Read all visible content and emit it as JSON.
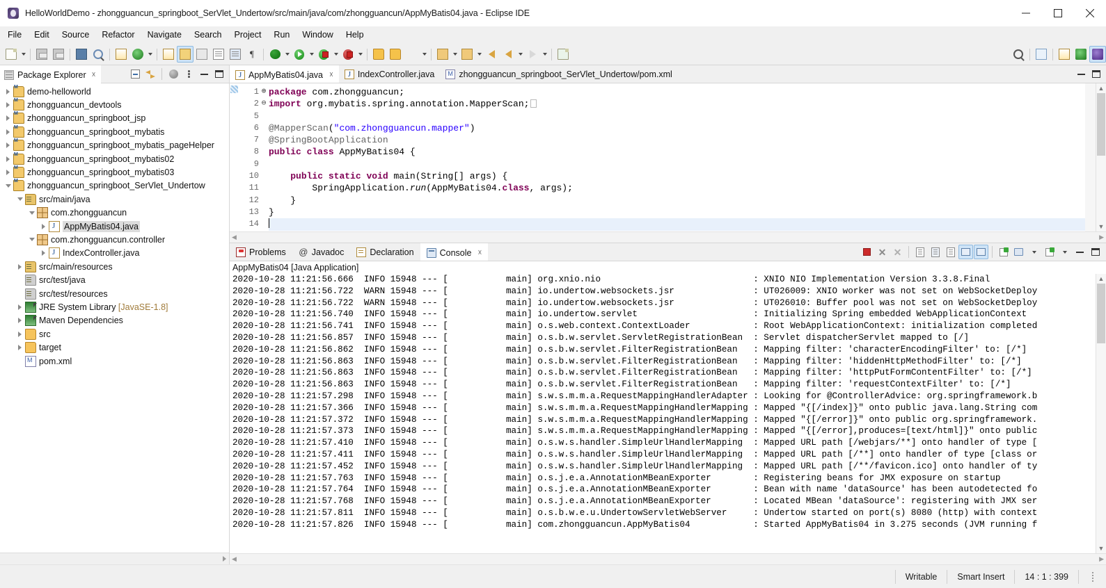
{
  "window": {
    "title": "HelloWorldDemo - zhongguancun_springboot_SerVlet_Undertow/src/main/java/com/zhongguancun/AppMyBatis04.java - Eclipse IDE",
    "app_icon": "eclipse-icon",
    "minimize": "—",
    "maximize": "□",
    "close": "✕"
  },
  "menubar": {
    "items": [
      {
        "label": "File"
      },
      {
        "label": "Edit"
      },
      {
        "label": "Source"
      },
      {
        "label": "Refactor"
      },
      {
        "label": "Navigate"
      },
      {
        "label": "Search"
      },
      {
        "label": "Project"
      },
      {
        "label": "Run"
      },
      {
        "label": "Window"
      },
      {
        "label": "Help"
      }
    ]
  },
  "toolbar": {
    "icons": [
      "new-wizard-icon",
      "save-icon",
      "save-all-icon",
      "print-icon",
      "search-icon",
      "open-task-icon",
      "refresh-icon",
      "annotate-icon",
      "edit-highlight-icon",
      "link-icon",
      "new-java-project-icon",
      "new-class-icon",
      "paragraph-icon",
      "debug-icon",
      "run-icon",
      "run-last-icon",
      "coverage-icon",
      "open-type-icon",
      "open-folder-icon",
      "pen-icon",
      "next-annotation-icon",
      "prev-annotation-icon",
      "back-icon",
      "forward-icon",
      "goto-icon",
      "new-file-icon"
    ],
    "right_icons": [
      "search-icon",
      "open-perspective-icon",
      "java-perspective-icon",
      "debug-perspective-icon",
      "java-ee-perspective-icon"
    ]
  },
  "package_explorer": {
    "tab_label": "Package Explorer",
    "tab_icon": "package-explorer-icon",
    "tools": [
      "collapse-all-icon",
      "link-with-editor-icon",
      "view-menu-globe-icon",
      "view-menu-icon",
      "minimize-icon",
      "maximize-icon"
    ],
    "tree": [
      {
        "label": "demo-helloworld",
        "indent": 0,
        "twist": "right",
        "icon": "maven-project-icon"
      },
      {
        "label": "zhongguancun_devtools",
        "indent": 0,
        "twist": "right",
        "icon": "maven-project-icon"
      },
      {
        "label": "zhongguancun_springboot_jsp",
        "indent": 0,
        "twist": "right",
        "icon": "maven-project-icon"
      },
      {
        "label": "zhongguancun_springboot_mybatis",
        "indent": 0,
        "twist": "right",
        "icon": "maven-project-icon"
      },
      {
        "label": "zhongguancun_springboot_mybatis_pageHelper",
        "indent": 0,
        "twist": "right",
        "icon": "maven-project-icon"
      },
      {
        "label": "zhongguancun_springboot_mybatis02",
        "indent": 0,
        "twist": "right",
        "icon": "maven-project-icon"
      },
      {
        "label": "zhongguancun_springboot_mybatis03",
        "indent": 0,
        "twist": "right",
        "icon": "maven-project-icon"
      },
      {
        "label": "zhongguancun_springboot_SerVlet_Undertow",
        "indent": 0,
        "twist": "down",
        "icon": "maven-project-icon"
      },
      {
        "label": "src/main/java",
        "indent": 1,
        "twist": "down",
        "icon": "source-folder-icon"
      },
      {
        "label": "com.zhongguancun",
        "indent": 2,
        "twist": "down",
        "icon": "package-icon"
      },
      {
        "label": "AppMyBatis04.java",
        "indent": 3,
        "twist": "right",
        "icon": "java-file-icon",
        "selected": true
      },
      {
        "label": "com.zhongguancun.controller",
        "indent": 2,
        "twist": "down",
        "icon": "package-icon"
      },
      {
        "label": "IndexController.java",
        "indent": 3,
        "twist": "right",
        "icon": "java-file-icon"
      },
      {
        "label": "src/main/resources",
        "indent": 1,
        "twist": "right",
        "icon": "source-folder-icon"
      },
      {
        "label": "src/test/java",
        "indent": 1,
        "twist": "none",
        "icon": "source-folder-gray-icon"
      },
      {
        "label": "src/test/resources",
        "indent": 1,
        "twist": "none",
        "icon": "source-folder-gray-icon"
      },
      {
        "label": "JRE System Library",
        "suffix": " [JavaSE-1.8]",
        "indent": 1,
        "twist": "right",
        "icon": "library-icon"
      },
      {
        "label": "Maven Dependencies",
        "indent": 1,
        "twist": "right",
        "icon": "library-icon"
      },
      {
        "label": "src",
        "indent": 1,
        "twist": "right",
        "icon": "folder-icon"
      },
      {
        "label": "target",
        "indent": 1,
        "twist": "right",
        "icon": "folder-icon"
      },
      {
        "label": "pom.xml",
        "indent": 1,
        "twist": "none",
        "icon": "xml-file-icon"
      }
    ]
  },
  "editor": {
    "tabs": [
      {
        "label": "AppMyBatis04.java",
        "icon": "java-file-icon",
        "active": true,
        "closable": true
      },
      {
        "label": "IndexController.java",
        "icon": "java-file-icon",
        "active": false,
        "closable": false
      },
      {
        "label": "zhongguancun_springboot_SerVlet_Undertow/pom.xml",
        "icon": "xml-file-icon",
        "active": false,
        "closable": false
      }
    ],
    "tools": [
      "minimize-icon",
      "maximize-icon"
    ],
    "line_numbers": [
      "1",
      "2",
      "5",
      "6",
      "7",
      "8",
      "9",
      "10",
      "11",
      "12",
      "13",
      "14"
    ],
    "fold_markers": [
      "",
      "⊕",
      "",
      "",
      "",
      "",
      "",
      "⊖",
      "",
      "",
      "",
      ""
    ],
    "code_lines": [
      "package com.zhongguancun;",
      "import org.mybatis.spring.annotation.MapperScan;",
      "",
      "@MapperScan(\"com.zhongguancun.mapper\")",
      "@SpringBootApplication",
      "public class AppMyBatis04 {",
      "",
      "    public static void main(String[] args) {",
      "        SpringApplication.run(AppMyBatis04.class, args);",
      "    }",
      "}",
      ""
    ],
    "current_line_index": 11
  },
  "console_view": {
    "tabs": [
      {
        "label": "Problems",
        "icon": "problems-icon",
        "active": false
      },
      {
        "label": "Javadoc",
        "icon": "javadoc-at-icon",
        "active": false
      },
      {
        "label": "Declaration",
        "icon": "declaration-icon",
        "active": false
      },
      {
        "label": "Console",
        "icon": "console-icon",
        "active": true,
        "closable": true
      }
    ],
    "tools": [
      "terminate-icon",
      "remove-launch-icon",
      "remove-all-terminated-icon",
      "clear-console-icon",
      "lock-scroll-icon",
      "word-wrap-icon",
      "scroll-lock-icon",
      "show-console-on-output-icon",
      "pin-console-icon",
      "display-selected-console-icon",
      "open-console-icon",
      "minimize-icon",
      "maximize-icon"
    ],
    "title": "AppMyBatis04 [Java Application]",
    "log_lines": [
      "2020-10-28 11:21:56.666  INFO 15948 --- [           main] org.xnio.nio                             : XNIO NIO Implementation Version 3.3.8.Final",
      "2020-10-28 11:21:56.722  WARN 15948 --- [           main] io.undertow.websockets.jsr               : UT026009: XNIO worker was not set on WebSocketDeploy",
      "2020-10-28 11:21:56.722  WARN 15948 --- [           main] io.undertow.websockets.jsr               : UT026010: Buffer pool was not set on WebSocketDeploy",
      "2020-10-28 11:21:56.740  INFO 15948 --- [           main] io.undertow.servlet                      : Initializing Spring embedded WebApplicationContext",
      "2020-10-28 11:21:56.741  INFO 15948 --- [           main] o.s.web.context.ContextLoader            : Root WebApplicationContext: initialization completed",
      "2020-10-28 11:21:56.857  INFO 15948 --- [           main] o.s.b.w.servlet.ServletRegistrationBean  : Servlet dispatcherServlet mapped to [/]",
      "2020-10-28 11:21:56.862  INFO 15948 --- [           main] o.s.b.w.servlet.FilterRegistrationBean   : Mapping filter: 'characterEncodingFilter' to: [/*]",
      "2020-10-28 11:21:56.863  INFO 15948 --- [           main] o.s.b.w.servlet.FilterRegistrationBean   : Mapping filter: 'hiddenHttpMethodFilter' to: [/*]",
      "2020-10-28 11:21:56.863  INFO 15948 --- [           main] o.s.b.w.servlet.FilterRegistrationBean   : Mapping filter: 'httpPutFormContentFilter' to: [/*]",
      "2020-10-28 11:21:56.863  INFO 15948 --- [           main] o.s.b.w.servlet.FilterRegistrationBean   : Mapping filter: 'requestContextFilter' to: [/*]",
      "2020-10-28 11:21:57.298  INFO 15948 --- [           main] s.w.s.m.m.a.RequestMappingHandlerAdapter : Looking for @ControllerAdvice: org.springframework.b",
      "2020-10-28 11:21:57.366  INFO 15948 --- [           main] s.w.s.m.m.a.RequestMappingHandlerMapping : Mapped \"{[/index]}\" onto public java.lang.String com",
      "2020-10-28 11:21:57.372  INFO 15948 --- [           main] s.w.s.m.m.a.RequestMappingHandlerMapping : Mapped \"{[/error]}\" onto public org.springframework.",
      "2020-10-28 11:21:57.373  INFO 15948 --- [           main] s.w.s.m.m.a.RequestMappingHandlerMapping : Mapped \"{[/error],produces=[text/html]}\" onto public",
      "2020-10-28 11:21:57.410  INFO 15948 --- [           main] o.s.w.s.handler.SimpleUrlHandlerMapping  : Mapped URL path [/webjars/**] onto handler of type [",
      "2020-10-28 11:21:57.411  INFO 15948 --- [           main] o.s.w.s.handler.SimpleUrlHandlerMapping  : Mapped URL path [/**] onto handler of type [class or",
      "2020-10-28 11:21:57.452  INFO 15948 --- [           main] o.s.w.s.handler.SimpleUrlHandlerMapping  : Mapped URL path [/**/favicon.ico] onto handler of ty",
      "2020-10-28 11:21:57.763  INFO 15948 --- [           main] o.s.j.e.a.AnnotationMBeanExporter        : Registering beans for JMX exposure on startup",
      "2020-10-28 11:21:57.764  INFO 15948 --- [           main] o.s.j.e.a.AnnotationMBeanExporter        : Bean with name 'dataSource' has been autodetected fo",
      "2020-10-28 11:21:57.768  INFO 15948 --- [           main] o.s.j.e.a.AnnotationMBeanExporter        : Located MBean 'dataSource': registering with JMX ser",
      "2020-10-28 11:21:57.811  INFO 15948 --- [           main] o.s.b.w.e.u.UndertowServletWebServer     : Undertow started on port(s) 8080 (http) with context",
      "2020-10-28 11:21:57.826  INFO 15948 --- [           main] com.zhongguancun.AppMyBatis04            : Started AppMyBatis04 in 3.275 seconds (JVM running f"
    ]
  },
  "statusbar": {
    "writable": "Writable",
    "insert_mode": "Smart Insert",
    "position": "14 : 1 : 399"
  },
  "colors": {
    "accent_selection": "#cfe4f7",
    "keyword": "#7f0055",
    "string": "#2a00ff",
    "annotation": "#646464",
    "current_line": "#e8f0fb",
    "chrome_bg": "#f0f0f0"
  }
}
